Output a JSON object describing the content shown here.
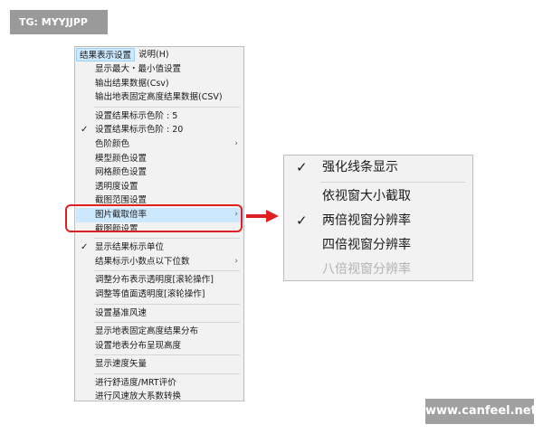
{
  "badges": {
    "tg": "TG: MYYJJPP",
    "watermark": "www.canfeel.net"
  },
  "menubar": {
    "items": [
      {
        "label": "结果表示设置"
      },
      {
        "label": "说明(H)"
      }
    ]
  },
  "menu": {
    "groups": [
      [
        {
          "label": "显示最大・最小值设置"
        },
        {
          "label": "输出结果数据(Csv)"
        },
        {
          "label": "输出地表固定高度结果数据(CSV)"
        }
      ],
      [
        {
          "label": "设置结果标示色阶 : 5"
        },
        {
          "label": "设置结果标示色阶 : 20"
        },
        {
          "label": "色阶颜色"
        },
        {
          "label": "模型颜色设置"
        },
        {
          "label": "网格颜色设置"
        },
        {
          "label": "透明度设置"
        },
        {
          "label": "截图范围设置"
        },
        {
          "label": "图片截取倍率"
        },
        {
          "label": "截图颜设置"
        }
      ],
      [
        {
          "label": "显示结果标示单位"
        },
        {
          "label": "结果标示小数点以下位数"
        }
      ],
      [
        {
          "label": "调整分布表示透明度[滚轮操作]"
        },
        {
          "label": "调整等值面透明度[滚轮操作]"
        }
      ],
      [
        {
          "label": "设置基准风速"
        }
      ],
      [
        {
          "label": "显示地表固定高度结果分布"
        },
        {
          "label": "设置地表分布呈现高度"
        }
      ],
      [
        {
          "label": "显示速度矢量"
        }
      ],
      [
        {
          "label": "进行舒适度/MRT评价"
        },
        {
          "label": "进行风速放大系数转换"
        }
      ]
    ]
  },
  "submenu": {
    "items": [
      {
        "label": "强化线条显示"
      },
      {
        "label": "依视窗大小截取"
      },
      {
        "label": "两倍视窗分辨率"
      },
      {
        "label": "四倍视窗分辨率"
      },
      {
        "label": "八倍视窗分辨率"
      }
    ]
  },
  "colors": {
    "highlight": "#cce8ff",
    "callout": "#e02020",
    "disabled_text": "#b3b3b3"
  }
}
